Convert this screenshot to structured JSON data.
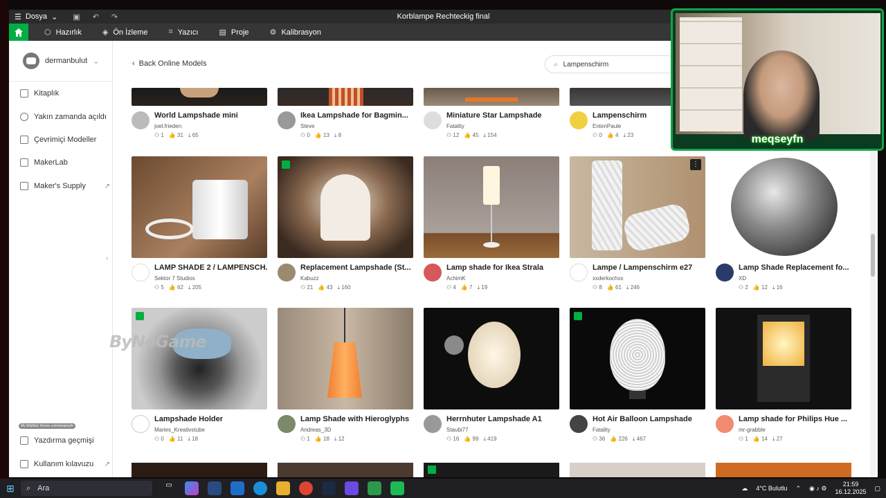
{
  "window": {
    "title": "Korblampe Rechteckig final",
    "menu_label": "Dosya"
  },
  "nav": {
    "items": [
      {
        "label": "Hazırlık",
        "icon": "cube-icon"
      },
      {
        "label": "Ön İzleme",
        "icon": "layers-icon"
      },
      {
        "label": "Yazıcı",
        "icon": "printer-icon"
      },
      {
        "label": "Proje",
        "icon": "project-icon"
      },
      {
        "label": "Kalibrasyon",
        "icon": "gear-icon"
      }
    ]
  },
  "sidebar": {
    "username": "dermanbulut",
    "items": [
      {
        "label": "Kitaplık"
      },
      {
        "label": "Yakın zamanda açıldı"
      },
      {
        "label": "Çevrimiçi Modeller"
      },
      {
        "label": "MakerLab"
      },
      {
        "label": "Maker's Supply"
      }
    ],
    "bottom_items": [
      {
        "label": "Yazdırma geçmişi"
      },
      {
        "label": "Kullanım kılavuzu"
      }
    ]
  },
  "content": {
    "back_label": "Back Online Models",
    "search_value": "Lampenschirm"
  },
  "cards": [
    {
      "title": "World Lampshade mini",
      "author": "joel.frieden",
      "stats": [
        "1",
        "31",
        "65"
      ]
    },
    {
      "title": "Ikea Lampshade for Bagmin...",
      "author": "Steve",
      "stats": [
        "0",
        "13",
        "8"
      ]
    },
    {
      "title": "Miniature Star Lampshade",
      "author": "Fatality",
      "stats": [
        "12",
        "45",
        "154"
      ]
    },
    {
      "title": "Lampenschirm",
      "author": "EntenPaule",
      "stats": [
        "0",
        "4",
        "23"
      ]
    },
    {
      "title": "LAMP SHADE 2 / LAMPENSCH...",
      "author": "Sektor 7 Studios",
      "stats": [
        "5",
        "62",
        "205"
      ]
    },
    {
      "title": "Replacement Lampshade (St...",
      "author": "Kabuzz",
      "stats": [
        "21",
        "43",
        "160"
      ]
    },
    {
      "title": "Lamp shade for Ikea Strala",
      "author": "AchimK",
      "stats": [
        "4",
        "7",
        "19"
      ]
    },
    {
      "title": "Lampe / Lampenschirm e27",
      "author": "xxderkochxx",
      "stats": [
        "8",
        "61",
        "246"
      ]
    },
    {
      "title": "Lamp Shade Replacement fo...",
      "author": "XD",
      "stats": [
        "2",
        "12",
        "16"
      ]
    },
    {
      "title": "Lampshade Holder",
      "author": "Maries_Kreativstube",
      "stats": [
        "0",
        "11",
        "18"
      ]
    },
    {
      "title": "Lamp Shade with Hieroglyphs",
      "author": "Andreas_3D",
      "stats": [
        "1",
        "18",
        "12"
      ]
    },
    {
      "title": "Herrnhuter Lampshade A1",
      "author": "Staubi77",
      "stats": [
        "16",
        "99",
        "419"
      ]
    },
    {
      "title": "Hot Air Balloon Lampshade",
      "author": "Fatality",
      "stats": [
        "36",
        "226",
        "467"
      ]
    },
    {
      "title": "Lamp shade for Philips Hue ...",
      "author": "mr-grabble",
      "stats": [
        "1",
        "14",
        "27"
      ]
    }
  ],
  "overlay": {
    "streamer_name": "meqseyfn",
    "watermark": "ByNoGame",
    "wishlist": "My Wishlist: throne.com/meqseyfn"
  },
  "taskbar": {
    "search_placeholder": "Ara",
    "weather": "4°C  Bulutlu",
    "time": "21:59",
    "date": "16.12.2025"
  },
  "colors": {
    "accent": "#00ae42",
    "navbar": "#363636",
    "titlebar": "#2b2b2b"
  }
}
